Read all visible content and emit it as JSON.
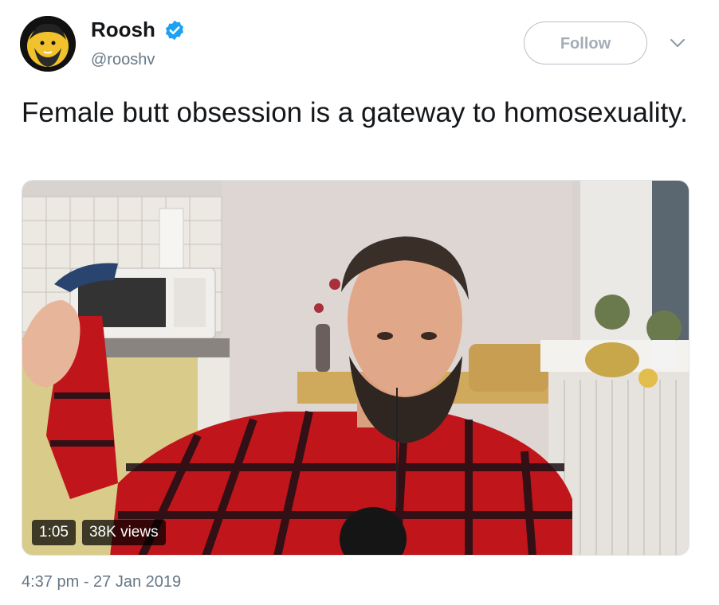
{
  "user": {
    "name": "Roosh",
    "handle": "@rooshv",
    "verified": true,
    "avatar_icon": "bearded-man-cartoon-avatar"
  },
  "follow": {
    "label": "Follow"
  },
  "menu": {
    "icon": "chevron-down-icon"
  },
  "tweet": {
    "text": "Female butt obsession is a gateway to homosexuality."
  },
  "video": {
    "duration": "1:05",
    "views": "38K views"
  },
  "timestamp": "4:37 pm - 27 Jan 2019",
  "colors": {
    "verified_blue": "#1da1f2",
    "handle_gray": "#657786",
    "flannel_red": "#c0151b"
  }
}
